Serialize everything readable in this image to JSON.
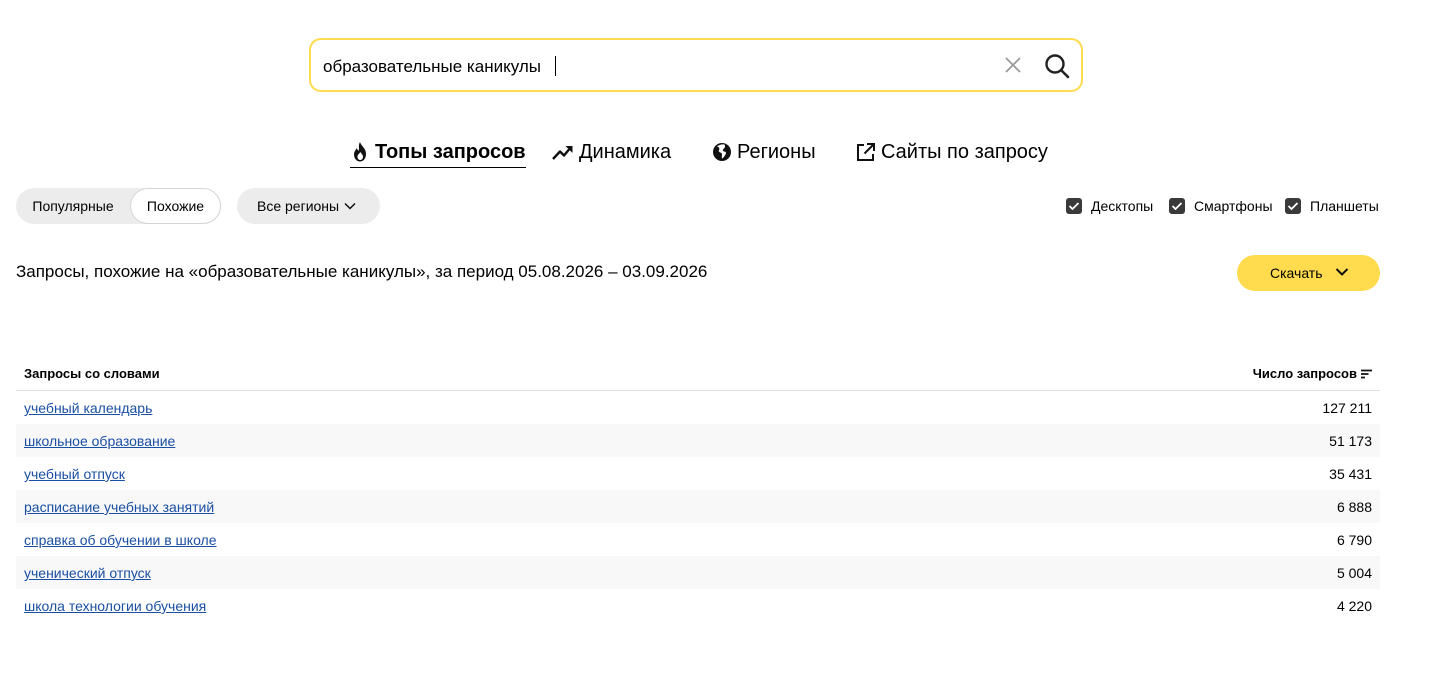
{
  "search": {
    "value": "образовательные каникулы",
    "clear_icon": "close-icon",
    "submit_icon": "search-icon"
  },
  "tabs": [
    {
      "label": "Топы запросов",
      "icon": "fire-icon",
      "active": true
    },
    {
      "label": "Динамика",
      "icon": "trend-icon",
      "active": false
    },
    {
      "label": "Регионы",
      "icon": "globe-icon",
      "active": false
    },
    {
      "label": "Сайты по запросу",
      "icon": "external-link-icon",
      "active": false
    }
  ],
  "filters": {
    "mode_popular": "Популярные",
    "mode_similar": "Похожие",
    "selected_mode": "Похожие",
    "region": "Все регионы"
  },
  "devices": [
    {
      "label": "Десктопы",
      "checked": true
    },
    {
      "label": "Смартфоны",
      "checked": true
    },
    {
      "label": "Планшеты",
      "checked": true
    }
  ],
  "result": {
    "heading": "Запросы, похожие на «образовательные каникулы», за период 05.08.2026 – 03.09.2026",
    "download_label": "Скачать"
  },
  "table": {
    "col_query": "Запросы со словами",
    "col_count": "Число запросов",
    "rows": [
      {
        "query": "учебный календарь",
        "count": "127 211"
      },
      {
        "query": "школьное образование",
        "count": "51 173"
      },
      {
        "query": "учебный отпуск",
        "count": "35 431"
      },
      {
        "query": "расписание учебных занятий",
        "count": "6 888"
      },
      {
        "query": "справка об обучении в школе",
        "count": "6 790"
      },
      {
        "query": "ученический отпуск",
        "count": "5 004"
      },
      {
        "query": "школа технологии обучения",
        "count": "4 220"
      }
    ]
  },
  "colors": {
    "accent": "#ffdb4d",
    "link": "#1a4fa3",
    "checkbox": "#3a3a3a"
  }
}
